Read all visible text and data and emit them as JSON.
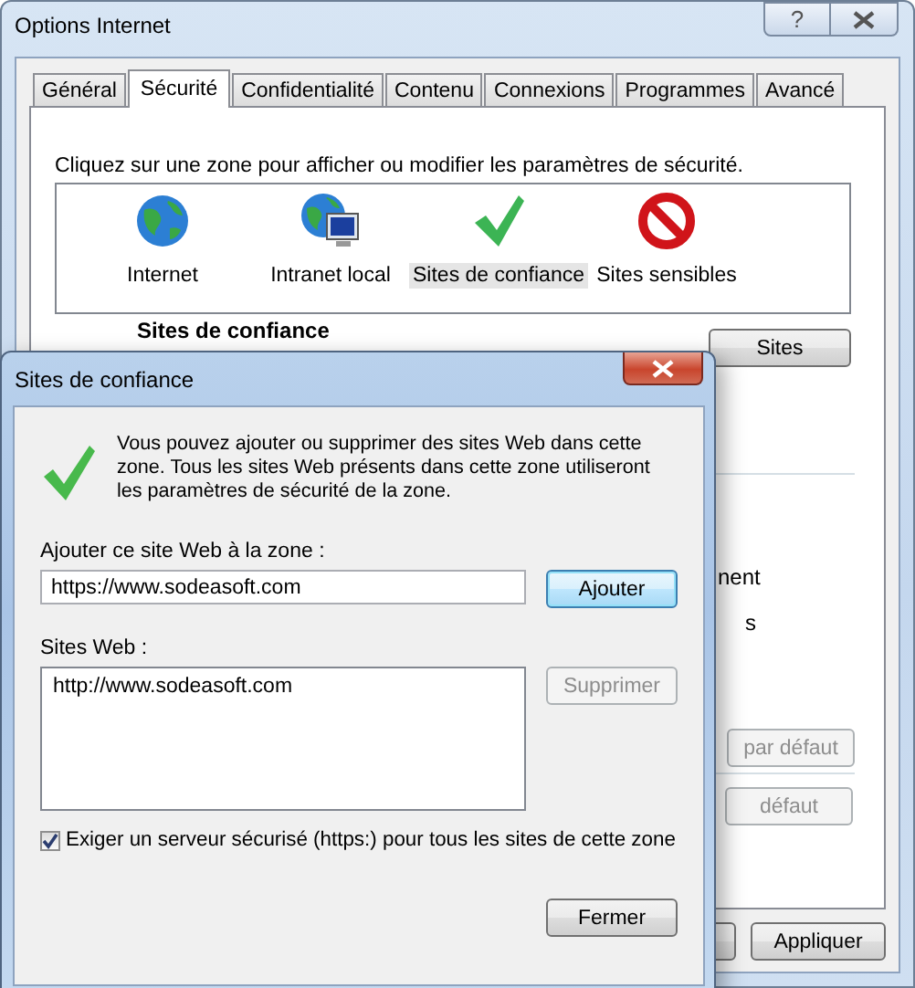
{
  "window": {
    "title": "Options Internet",
    "help_button": "?"
  },
  "tabs": [
    {
      "label": "Général",
      "selected": false
    },
    {
      "label": "Sécurité",
      "selected": true
    },
    {
      "label": "Confidentialité",
      "selected": false
    },
    {
      "label": "Contenu",
      "selected": false
    },
    {
      "label": "Connexions",
      "selected": false
    },
    {
      "label": "Programmes",
      "selected": false
    },
    {
      "label": "Avancé",
      "selected": false
    }
  ],
  "security": {
    "instruction": "Cliquez sur une zone pour afficher ou modifier les paramètres de sécurité.",
    "zones": [
      {
        "label": "Internet",
        "kind": "globe",
        "selected": false
      },
      {
        "label": "Intranet local",
        "kind": "intranet",
        "selected": false
      },
      {
        "label": "Sites de confiance",
        "kind": "trusted",
        "selected": true
      },
      {
        "label": "Sites sensibles",
        "kind": "restricted",
        "selected": false
      }
    ],
    "zone_title": "Sites de confiance",
    "sites_button": "Sites",
    "level_fragment_1": "nent",
    "level_fragment_2": "s",
    "default_button_1": "par défaut",
    "default_button_2": "défaut"
  },
  "footer_buttons": [
    "Appliquer"
  ],
  "dialog": {
    "title": "Sites de confiance",
    "description": "Vous pouvez ajouter ou supprimer des sites Web dans cette zone. Tous les sites Web présents dans cette zone utiliseront les paramètres de sécurité de la zone.",
    "add_label": "Ajouter ce site Web à la zone :",
    "add_value": "https://www.sodeasoft.com",
    "add_button": "Ajouter",
    "list_label": "Sites Web :",
    "sites": [
      "http://www.sodeasoft.com"
    ],
    "remove_button": {
      "label": "Supprimer",
      "disabled": true
    },
    "https_required": {
      "label": "Exiger un serveur sécurisé (https:) pour tous les sites de cette zone",
      "checked": true
    },
    "close_button": "Fermer"
  }
}
